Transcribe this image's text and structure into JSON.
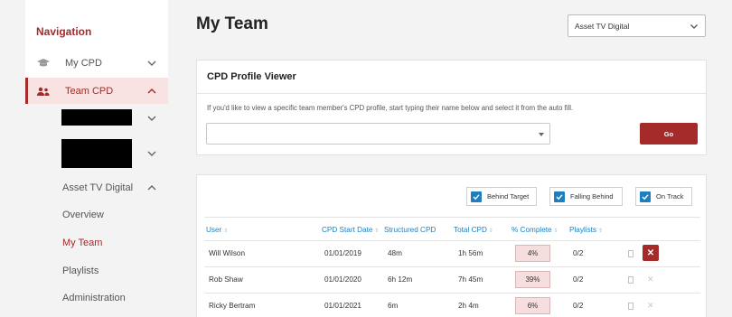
{
  "sidebar": {
    "title": "Navigation",
    "items": [
      {
        "label": "My CPD",
        "icon": "graduation-cap-icon"
      },
      {
        "label": "Team CPD",
        "icon": "users-icon"
      }
    ],
    "sub_items": [
      {
        "label": "Asset TV Digital"
      },
      {
        "label": "Overview"
      },
      {
        "label": "My Team"
      },
      {
        "label": "Playlists"
      },
      {
        "label": "Administration"
      }
    ],
    "accent": "#a52a2a"
  },
  "header": {
    "title": "My Team",
    "org_select": "Asset TV Digital"
  },
  "profile_viewer": {
    "title": "CPD Profile Viewer",
    "help": "If you'd like to view a specific team member's CPD profile, start typing their name below and select it from the auto fill.",
    "input_value": "",
    "go_label": "Go"
  },
  "team": {
    "filters": [
      {
        "label": "Behind Target",
        "checked": true
      },
      {
        "label": "Falling Behind",
        "checked": true
      },
      {
        "label": "On Track",
        "checked": true
      }
    ],
    "columns": [
      "User",
      "CPD Start Date",
      "Structured CPD",
      "Total CPD",
      "% Complete",
      "Playlists"
    ],
    "rows": [
      {
        "user": "Will Wilson",
        "start": "01/01/2019",
        "structured": "48m",
        "total": "1h 56m",
        "pct": "4%",
        "playlists": "0/2"
      },
      {
        "user": "Rob Shaw",
        "start": "01/01/2020",
        "structured": "6h 12m",
        "total": "7h 45m",
        "pct": "39%",
        "playlists": "0/2"
      },
      {
        "user": "Ricky Bertram",
        "start": "01/01/2021",
        "structured": "6m",
        "total": "2h 4m",
        "pct": "6%",
        "playlists": "0/2"
      }
    ],
    "link_color": "#1c7fc0"
  }
}
